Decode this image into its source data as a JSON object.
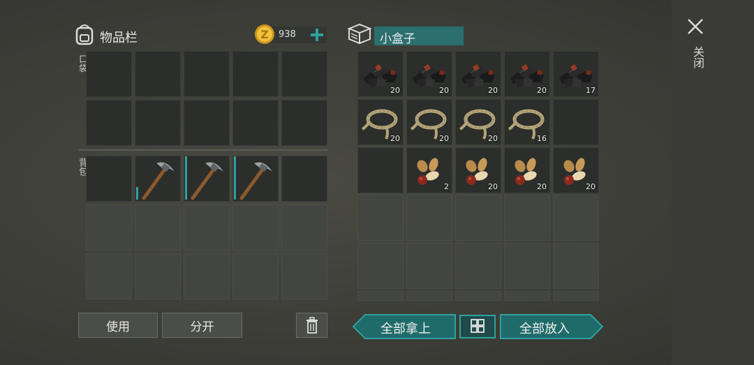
{
  "inventory": {
    "title": "物品栏",
    "coins": "938",
    "pocket_label": "口袋",
    "backpack_label": "背包",
    "use_label": "使用",
    "split_label": "分开"
  },
  "container": {
    "title": "小盒子",
    "take_all_label": "全部拿上",
    "put_all_label": "全部放入"
  },
  "close_label": "关闭",
  "backpack_items": [
    {
      "item": "empty",
      "count": ""
    },
    {
      "item": "pickaxe",
      "count": ""
    },
    {
      "item": "pickaxe",
      "count": ""
    },
    {
      "item": "pickaxe",
      "count": ""
    },
    {
      "item": "empty",
      "count": ""
    }
  ],
  "container_items": [
    [
      {
        "item": "coal",
        "count": "20"
      },
      {
        "item": "coal",
        "count": "20"
      },
      {
        "item": "coal",
        "count": "20"
      },
      {
        "item": "coal",
        "count": "20"
      },
      {
        "item": "coal",
        "count": "17"
      }
    ],
    [
      {
        "item": "rope",
        "count": "20"
      },
      {
        "item": "rope",
        "count": "20"
      },
      {
        "item": "rope",
        "count": "20"
      },
      {
        "item": "rope",
        "count": "16"
      },
      {
        "item": "empty",
        "count": ""
      }
    ],
    [
      {
        "item": "empty",
        "count": ""
      },
      {
        "item": "seeds",
        "count": "2"
      },
      {
        "item": "seeds",
        "count": "20"
      },
      {
        "item": "seeds",
        "count": "20"
      },
      {
        "item": "seeds",
        "count": "20"
      }
    ]
  ],
  "colors": {
    "accent": "#2fa1a0",
    "accent_dark": "#1f6b6a",
    "slot_dark": "#2b2e2b",
    "slot_empty": "#424540"
  }
}
